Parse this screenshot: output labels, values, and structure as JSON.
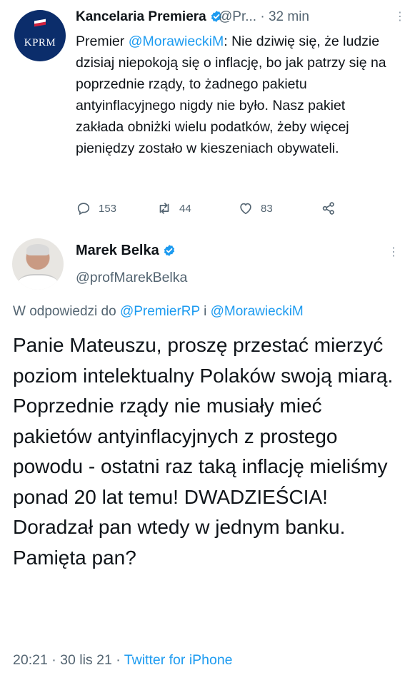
{
  "first_tweet": {
    "author_name": "Kancelaria Premiera",
    "handle": "@Pr...",
    "separator": "·",
    "time": "32 min",
    "avatar_text": "KPRM",
    "text_prefix": "Premier ",
    "mention": "@MorawieckiM",
    "text_body": ": Nie dziwię się, że ludzie dzisiaj niepokoją się o inflację, bo jak patrzy się na poprzednie rządy, to żadnego pakietu antyinflacyjnego nigdy nie było. Nasz pakiet zakłada obniżki wielu podatków, żeby więcej pieniędzy zostało w kieszeniach obywateli.",
    "replies": "153",
    "retweets": "44",
    "likes": "83"
  },
  "second_tweet": {
    "author_name": "Marek Belka",
    "handle": "@profMarekBelka",
    "reply_prefix": "W odpowiedzi do ",
    "reply_mention_1": "@PremierRP",
    "reply_join": " i ",
    "reply_mention_2": "@MorawieckiM",
    "text": "Panie Mateuszu, proszę przestać mierzyć poziom intelektualny Polaków swoją miarą. Poprzednie rządy nie musiały mieć pakietów antyinflacyjnych z prostego powodu - ostatni raz taką inflację mieliśmy ponad 20 lat temu! DWADZIEŚCIA! Doradzał pan wtedy w jednym banku. Pamięta pan?",
    "time": "20:21",
    "date": "30 lis 21",
    "source": "Twitter for iPhone",
    "separator": "·"
  },
  "colors": {
    "link": "#1d9bf0",
    "secondary": "#536471",
    "text": "#0f1419"
  },
  "icons": [
    "verified-badge-icon",
    "more-icon",
    "reply-icon",
    "retweet-icon",
    "like-icon",
    "share-icon"
  ]
}
